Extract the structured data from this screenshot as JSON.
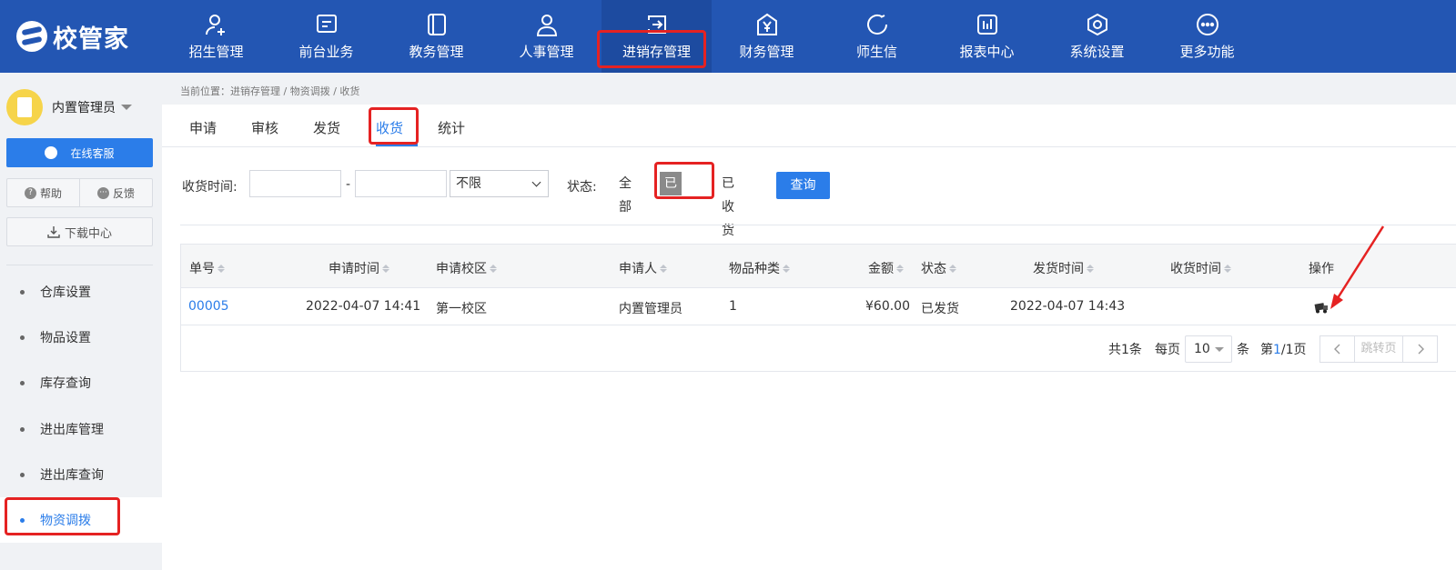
{
  "app": {
    "logo_text": "校管家"
  },
  "nav": {
    "items": [
      {
        "label": "招生管理",
        "icon": "user-plus-icon"
      },
      {
        "label": "前台业务",
        "icon": "monitor-icon"
      },
      {
        "label": "教务管理",
        "icon": "book-icon"
      },
      {
        "label": "人事管理",
        "icon": "person-icon"
      },
      {
        "label": "进销存管理",
        "icon": "inout-icon"
      },
      {
        "label": "财务管理",
        "icon": "yen-icon"
      },
      {
        "label": "师生信",
        "icon": "message-icon"
      },
      {
        "label": "报表中心",
        "icon": "report-icon"
      },
      {
        "label": "系统设置",
        "icon": "settings-icon"
      },
      {
        "label": "更多功能",
        "icon": "more-icon"
      }
    ],
    "active_index": 4
  },
  "sidebar": {
    "user_name": "内置管理员",
    "service_label": "在线客服",
    "help_label": "帮助",
    "help_glyph": "?",
    "feedback_label": "反馈",
    "feedback_glyph": "···",
    "download_label": "下载中心",
    "items": [
      {
        "label": "仓库设置"
      },
      {
        "label": "物品设置"
      },
      {
        "label": "库存查询"
      },
      {
        "label": "进出库管理"
      },
      {
        "label": "进出库查询"
      },
      {
        "label": "物资调拨"
      }
    ],
    "active_index": 5
  },
  "breadcrumb": "当前位置：进销存管理 / 物资调拨 / 收货",
  "tabs": [
    "申请",
    "审核",
    "发货",
    "收货",
    "统计"
  ],
  "active_tab": 3,
  "filter": {
    "time_label": "收货时间:",
    "range_sep": "-",
    "range_select": "不限",
    "status_label": "状态:",
    "status_options": [
      "全部",
      "已发货",
      "已收货"
    ],
    "status_selected": 1,
    "query_label": "查询"
  },
  "table": {
    "columns": [
      "单号",
      "申请时间",
      "申请校区",
      "申请人",
      "物品种类",
      "金额",
      "状态",
      "发货时间",
      "收货时间",
      "操作"
    ],
    "rows": [
      {
        "id": "00005",
        "apply_time": "2022-04-07 14:41",
        "campus": "第一校区",
        "applicant": "内置管理员",
        "item_types": "1",
        "amount": "¥60.00",
        "status": "已发货",
        "ship_time": "2022-04-07 14:43",
        "receive_time": "",
        "action_icon": "receive-truck-icon"
      }
    ]
  },
  "pagination": {
    "total": "共1条",
    "per_page_label": "每页",
    "page_size": "10",
    "unit": "条",
    "page_prefix": "第",
    "page_current": "1",
    "page_suffix": "/1页",
    "jump_placeholder": "跳转页"
  },
  "colors": {
    "nav_bg": "#2356b3",
    "accent": "#2b7de9",
    "highlight_box": "#e52222",
    "selected_status_bg": "#8a8a8a"
  }
}
